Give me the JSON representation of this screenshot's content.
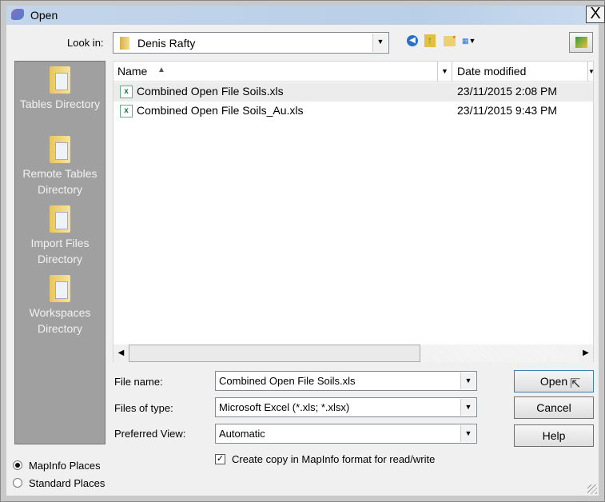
{
  "window": {
    "title": "Open",
    "close_label": "X"
  },
  "look_in": {
    "label": "Look in:",
    "value": "Denis Rafty"
  },
  "toolbar": {
    "icons": [
      "back-icon",
      "up-folder-icon",
      "new-folder-icon",
      "view-menu-icon"
    ],
    "extra_icon": "open-database-icon"
  },
  "places": [
    {
      "label": "Tables Directory"
    },
    {
      "label": "Remote Tables Directory"
    },
    {
      "label": "Import Files Directory"
    },
    {
      "label": "Workspaces Directory"
    }
  ],
  "file_list": {
    "columns": [
      "Name",
      "Date modified"
    ],
    "rows": [
      {
        "name": "Combined Open File Soils.xls",
        "date": "23/11/2015 2:08 PM"
      },
      {
        "name": "Combined Open File Soils_Au.xls",
        "date": "23/11/2015 9:43 PM"
      }
    ]
  },
  "form": {
    "file_name_label": "File name:",
    "file_name_value": "Combined Open File Soils.xls",
    "files_of_type_label": "Files of type:",
    "files_of_type_value": "Microsoft Excel (*.xls; *.xlsx)",
    "preferred_view_label": "Preferred View:",
    "preferred_view_value": "Automatic",
    "copy_checkbox_label": "Create copy in MapInfo format for read/write",
    "copy_checked": true
  },
  "buttons": {
    "open": "Open",
    "cancel": "Cancel",
    "help": "Help"
  },
  "radios": {
    "mapinfo": "MapInfo Places",
    "standard": "Standard Places",
    "selected": "mapinfo"
  }
}
